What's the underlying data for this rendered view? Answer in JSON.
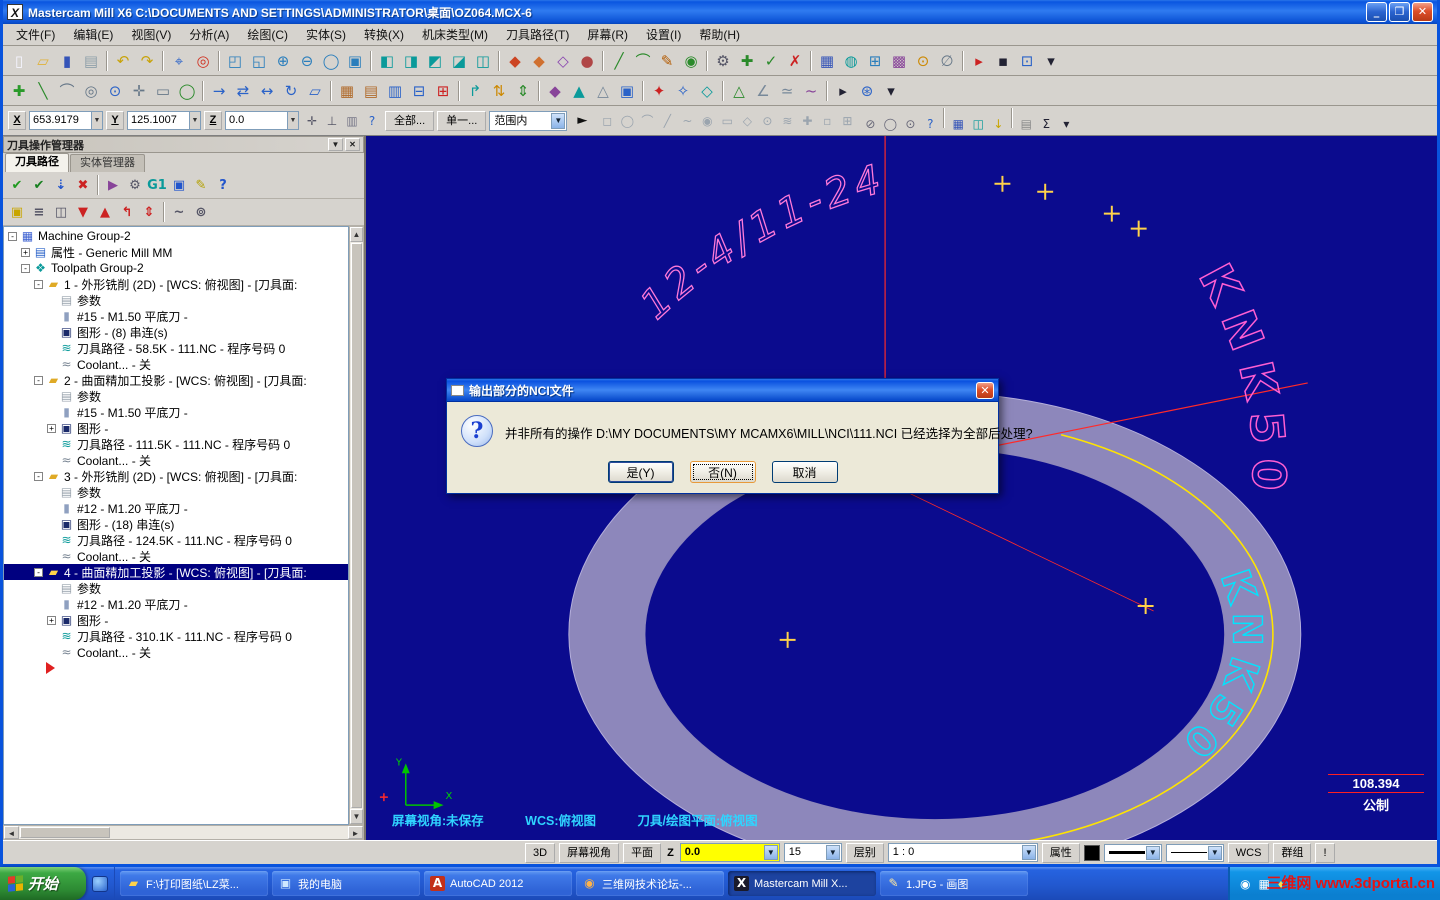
{
  "window": {
    "title": "Mastercam Mill X6  C:\\DOCUMENTS AND SETTINGS\\ADMINISTRATOR\\桌面\\OZ064.MCX-6",
    "minimize": "_",
    "maximize": "❐",
    "close": "✕"
  },
  "menu": {
    "items": [
      "文件(F)",
      "编辑(E)",
      "视图(V)",
      "分析(A)",
      "绘图(C)",
      "实体(S)",
      "转换(X)",
      "机床类型(M)",
      "刀具路径(T)",
      "屏幕(R)",
      "设置(I)",
      "帮助(H)"
    ]
  },
  "toolbar1": {
    "icons": [
      [
        "▯",
        "#f5f5ff",
        "new-file-icon"
      ],
      [
        "▱",
        "#e0b23a",
        "open-file-icon"
      ],
      [
        "▮",
        "#3554b8",
        "save-icon"
      ],
      [
        "▤",
        "#8fa0aa",
        "print-icon"
      ],
      "|",
      [
        "↶",
        "#c8a30a",
        "undo-icon"
      ],
      [
        "↷",
        "#c8a30a",
        "redo-icon"
      ],
      "|",
      [
        "⌖",
        "#2a62c8"
      ],
      [
        "◎",
        "#d03020"
      ],
      "|",
      [
        "◰",
        "#2a7ebc"
      ],
      [
        "◱",
        "#2a7ebc"
      ],
      [
        "⊕",
        "#2a7ebc",
        "zoom-in-icon"
      ],
      [
        "⊖",
        "#2a7ebc",
        "zoom-out-icon"
      ],
      [
        "◯",
        "#2a7ebc"
      ],
      [
        "▣",
        "#2a7ebc"
      ],
      "|",
      [
        "◧",
        "#0a9a9a"
      ],
      [
        "◨",
        "#0a9a9a"
      ],
      [
        "◩",
        "#0a9a9a"
      ],
      [
        "◪",
        "#0a9a9a"
      ],
      [
        "◫",
        "#0a9a9a"
      ],
      "|",
      [
        "◆",
        "#cc4422"
      ],
      [
        "◆",
        "#d07030"
      ],
      [
        "◇",
        "#8a46b0"
      ],
      [
        "●",
        "#b04646"
      ],
      "|",
      [
        "╱",
        "#2a8a2a"
      ],
      [
        "⌒",
        "#2a8a2a"
      ],
      [
        "✎",
        "#b35a00"
      ],
      [
        "◉",
        "#2a8a2a"
      ],
      "|",
      [
        "⚙",
        "#555566"
      ],
      [
        "✚",
        "#2a8a2a"
      ],
      [
        "✓",
        "#2a8a2a"
      ],
      [
        "✗",
        "#cc2222"
      ],
      "|",
      [
        "▦",
        "#3554b8"
      ],
      [
        "◍",
        "#0a9a9a"
      ],
      [
        "⊞",
        "#2a7ebc"
      ],
      [
        "▩",
        "#884499"
      ],
      [
        "⊙",
        "#cc8800"
      ],
      [
        "∅",
        "#667788"
      ],
      "|",
      [
        "▸",
        "#cc2222"
      ],
      [
        "▪",
        "#222233"
      ],
      [
        "⊡",
        "#2a62c8"
      ],
      [
        "▾",
        "#222233"
      ]
    ]
  },
  "toolbar2": {
    "icons": [
      [
        "✚",
        "#2a9a2a"
      ],
      [
        "╲",
        "#2a8a2a"
      ],
      [
        "⌒",
        "#667788"
      ],
      [
        "◎",
        "#667788"
      ],
      [
        "⊙",
        "#2a62c8"
      ],
      [
        "✛",
        "#667788"
      ],
      [
        "▭",
        "#667788"
      ],
      [
        "◯",
        "#2a8a2a"
      ],
      "|",
      [
        "→",
        "#2a62c8"
      ],
      [
        "⇄",
        "#2a62c8"
      ],
      [
        "↔",
        "#2a62c8"
      ],
      [
        "↻",
        "#2a62c8"
      ],
      [
        "▱",
        "#2a62c8"
      ],
      "|",
      [
        "▦",
        "#b06a2a"
      ],
      [
        "▤",
        "#b06a2a"
      ],
      [
        "▥",
        "#2a62c8"
      ],
      [
        "⊟",
        "#2a62c8"
      ],
      [
        "⊞",
        "#cc2222"
      ],
      "|",
      [
        "↱",
        "#0a9a9a"
      ],
      [
        "⇅",
        "#cc8800"
      ],
      [
        "⇕",
        "#2a8a2a"
      ],
      "|",
      [
        "◆",
        "#884499"
      ],
      [
        "▲",
        "#0a9a9a"
      ],
      [
        "△",
        "#778899"
      ],
      [
        "▣",
        "#2a62c8"
      ],
      "|",
      [
        "✦",
        "#cc2222"
      ],
      [
        "✧",
        "#2a62c8"
      ],
      [
        "◇",
        "#0a9a9a"
      ],
      "|",
      [
        "△",
        "#2a8a2a"
      ],
      [
        "∠",
        "#778899"
      ],
      [
        "≃",
        "#778899"
      ],
      [
        "~",
        "#884499"
      ],
      "|",
      [
        "▸",
        "#222233"
      ],
      [
        "⊛",
        "#2a62c8"
      ],
      [
        "▾",
        "#222233"
      ]
    ]
  },
  "coordbar": {
    "x_label": "X",
    "x_value": "653.9179",
    "y_label": "Y",
    "y_value": "125.1007",
    "z_label": "Z",
    "z_value": "0.0",
    "all_button": "全部...",
    "single_button": "单一...",
    "range_select": "范围内",
    "cursor": "►",
    "icons_a": [
      [
        "✛",
        "#556"
      ],
      [
        "⊥",
        "#556"
      ],
      [
        "▥",
        "#778"
      ],
      [
        "?",
        "#2a62c8"
      ]
    ],
    "icons_b": [
      [
        "◻",
        "#9aa4ae"
      ],
      [
        "◯",
        "#9aa4ae"
      ],
      [
        "⌒",
        "#9aa4ae"
      ],
      [
        "╱",
        "#9aa4ae"
      ],
      [
        "~",
        "#9aa4ae"
      ],
      [
        "◉",
        "#9aa4ae"
      ],
      [
        "▭",
        "#9aa4ae"
      ],
      [
        "◇",
        "#9aa4ae"
      ],
      [
        "⊙",
        "#9aa4ae"
      ],
      [
        "≋",
        "#9aa4ae"
      ],
      [
        "✚",
        "#9aa4ae"
      ],
      [
        "▫",
        "#9aa4ae"
      ],
      [
        "⊞",
        "#9aa4ae"
      ]
    ],
    "icons_c": [
      [
        "⊘",
        "#667"
      ],
      [
        "◯",
        "#667"
      ],
      [
        "⊙",
        "#667"
      ],
      [
        "?",
        "#2a62c8"
      ],
      "|",
      [
        "▦",
        "#3554b8"
      ],
      [
        "◫",
        "#0a9a9a"
      ],
      [
        "↓",
        "#c8a500"
      ],
      "|",
      [
        "▤",
        "#888"
      ],
      [
        "Σ",
        "#223"
      ],
      [
        "▾",
        "#223"
      ]
    ]
  },
  "manager": {
    "title": "刀具操作管理器",
    "menu_button": "▼",
    "close_button": "✕",
    "tabs": [
      "刀具路径",
      "实体管理器"
    ],
    "tools_row1": [
      [
        "✔",
        "#1f9a1f",
        "select-all-operations-icon"
      ],
      [
        "✔",
        "#16801f",
        "regen-all-icon"
      ],
      [
        "⇣",
        "#2255cc"
      ],
      [
        "✖",
        "#cc2222",
        "delete-icon"
      ],
      "|",
      [
        "▶",
        "#884499"
      ],
      [
        "⚙",
        "#555566"
      ],
      [
        "G1",
        "#0a9a9a",
        "g1-icon"
      ],
      [
        "▣",
        "#2255cc"
      ],
      [
        "✎",
        "#b3a000"
      ],
      [
        "?",
        "#2255cc",
        "help-icon"
      ]
    ],
    "tools_row2": [
      [
        "▣",
        "#c8a500",
        "lock-icon"
      ],
      [
        "≡",
        "#555566"
      ],
      [
        "◫",
        "#555566"
      ],
      [
        "▼",
        "#cc2222",
        "move-down-icon"
      ],
      [
        "▲",
        "#cc2222",
        "move-up-icon"
      ],
      [
        "↰",
        "#cc2222"
      ],
      [
        "⇕",
        "#cc2222"
      ],
      "|",
      [
        "~",
        "#555566"
      ],
      [
        "⊚",
        "#555566"
      ]
    ],
    "tree": [
      {
        "l": 0,
        "i": "machine",
        "t": "Machine Group-2",
        "e": "-"
      },
      {
        "l": 1,
        "i": "properties",
        "t": "属性 - Generic Mill MM",
        "e": "+"
      },
      {
        "l": 1,
        "i": "group",
        "t": "Toolpath Group-2",
        "e": "-"
      },
      {
        "l": 2,
        "i": "folder",
        "t": "1 - 外形铣削 (2D) - [WCS: 俯视图] - [刀具面:",
        "e": "-"
      },
      {
        "l": 3,
        "i": "params",
        "t": "参数"
      },
      {
        "l": 3,
        "i": "tool",
        "t": "#15 - M1.50 平底刀 -"
      },
      {
        "l": 3,
        "i": "geometry",
        "t": "图形 - (8) 串连(s)"
      },
      {
        "l": 3,
        "i": "toolpath",
        "t": "刀具路径 - 58.5K - 111.NC - 程序号码 0"
      },
      {
        "l": 3,
        "i": "coolant",
        "t": "Coolant... - 关"
      },
      {
        "l": 2,
        "i": "folder",
        "t": "2 - 曲面精加工投影 - [WCS: 俯视图] - [刀具面:",
        "e": "-"
      },
      {
        "l": 3,
        "i": "params",
        "t": "参数"
      },
      {
        "l": 3,
        "i": "tool",
        "t": "#15 - M1.50 平底刀 -"
      },
      {
        "l": 3,
        "i": "geometry",
        "t": "图形 -",
        "e": "+"
      },
      {
        "l": 3,
        "i": "toolpath",
        "t": "刀具路径 - 111.5K - 111.NC - 程序号码 0"
      },
      {
        "l": 3,
        "i": "coolant",
        "t": "Coolant... - 关"
      },
      {
        "l": 2,
        "i": "folder",
        "t": "3 - 外形铣削 (2D) - [WCS: 俯视图] - [刀具面:",
        "e": "-"
      },
      {
        "l": 3,
        "i": "params",
        "t": "参数"
      },
      {
        "l": 3,
        "i": "tool",
        "t": "#12 - M1.20 平底刀 -"
      },
      {
        "l": 3,
        "i": "geometry",
        "t": "图形 - (18) 串连(s)"
      },
      {
        "l": 3,
        "i": "toolpath",
        "t": "刀具路径 - 124.5K - 111.NC - 程序号码 0"
      },
      {
        "l": 3,
        "i": "coolant",
        "t": "Coolant... - 关"
      },
      {
        "l": 2,
        "i": "folder",
        "t": "4 - 曲面精加工投影 - [WCS: 俯视图] - [刀具面:",
        "e": "-",
        "sel": true
      },
      {
        "l": 3,
        "i": "params",
        "t": "参数"
      },
      {
        "l": 3,
        "i": "tool",
        "t": "#12 - M1.20 平底刀 -"
      },
      {
        "l": 3,
        "i": "geometry",
        "t": "图形 -",
        "e": "+"
      },
      {
        "l": 3,
        "i": "toolpath",
        "t": "刀具路径 - 310.1K - 111.NC - 程序号码 0"
      },
      {
        "l": 3,
        "i": "coolant",
        "t": "Coolant... - 关"
      },
      {
        "l": 2,
        "i": "insert",
        "t": ""
      }
    ]
  },
  "viewport": {
    "arc_text": "12-4/11-24",
    "ring_text_pink": "KNK50",
    "ring_text_cyan": "KNK50",
    "status_view": "屏幕视角:未保存",
    "status_wcs": "WCS:俯视图",
    "status_plane": "刀具/绘图平面:俯视图",
    "dim_value": "108.394",
    "dim_unit": "公制",
    "axis_x": "X",
    "axis_y": "Y"
  },
  "dialog": {
    "title": "输出部分的NCI文件",
    "question_mark": "?",
    "message": "并非所有的操作 D:\\MY DOCUMENTS\\MY MCAMX6\\MILL\\NCI\\111.NCI 已经选择为全部后处理?",
    "buttons": [
      "是(Y)",
      "否(N)",
      "取消"
    ],
    "close": "✕"
  },
  "bottom_bar": {
    "d3": "3D",
    "screen_view": "屏幕视角",
    "plane": "平面",
    "z_label": "Z",
    "z_value": "0.0",
    "tol": "15",
    "layer_label": "层别",
    "layer_value": "1 : 0",
    "attr": "属性",
    "wcs": "WCS",
    "group": "群组",
    "warn": "!"
  },
  "taskbar": {
    "start": "开始",
    "items": [
      {
        "label": "F:\\打印图纸\\LZ菜...",
        "icon": "folder"
      },
      {
        "label": "我的电脑",
        "icon": "computer"
      },
      {
        "label": "AutoCAD 2012",
        "icon": "autocad"
      },
      {
        "label": "三维网技术论坛-...",
        "icon": "browser"
      },
      {
        "label": "Mastercam Mill X...",
        "icon": "mastercam",
        "active": true
      },
      {
        "label": "1.JPG - 画图",
        "icon": "paint"
      }
    ],
    "tray_icons": [
      [
        "◉",
        "#ffffff"
      ],
      [
        "▦",
        "#ffffff"
      ],
      [
        "♦",
        "#ffe24a"
      ]
    ],
    "watermark": "三维网 www.3dportal.cn"
  }
}
